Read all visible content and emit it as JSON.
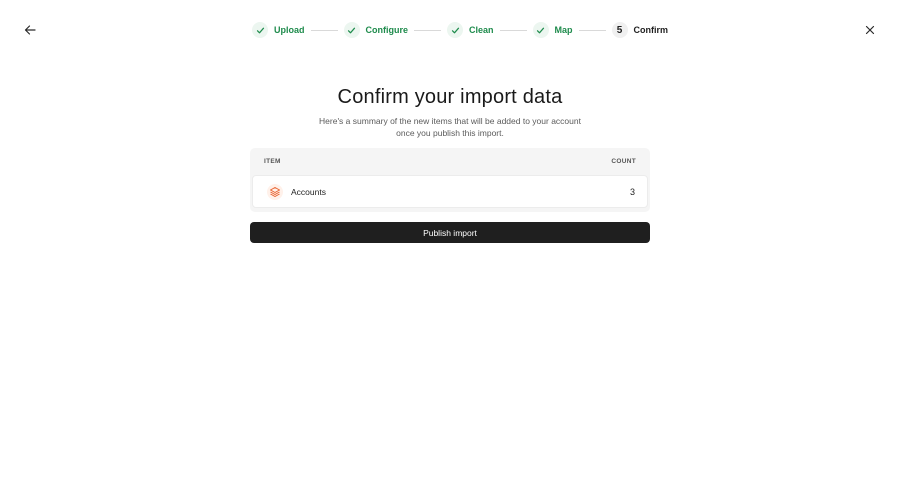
{
  "nav": {
    "back_icon": "arrow-left-icon",
    "close_icon": "close-icon"
  },
  "stepper": {
    "steps": [
      {
        "label": "Upload",
        "status": "complete",
        "icon": "check-icon"
      },
      {
        "label": "Configure",
        "status": "complete",
        "icon": "check-icon"
      },
      {
        "label": "Clean",
        "status": "complete",
        "icon": "check-icon"
      },
      {
        "label": "Map",
        "status": "complete",
        "icon": "check-icon"
      },
      {
        "label": "Confirm",
        "status": "current",
        "number": "5"
      }
    ]
  },
  "header": {
    "title": "Confirm your import data",
    "subtitle": "Here's a summary of the new items that will be added to your account once you publish this import."
  },
  "table": {
    "columns": {
      "item": "ITEM",
      "count": "COUNT"
    },
    "rows": [
      {
        "label": "Accounts",
        "count": "3",
        "icon": "layers-icon"
      }
    ]
  },
  "actions": {
    "publish_label": "Publish import"
  },
  "colors": {
    "success": "#1e8b4c",
    "accent_orange": "#e8602c",
    "button_dark": "#1f1f1f"
  }
}
